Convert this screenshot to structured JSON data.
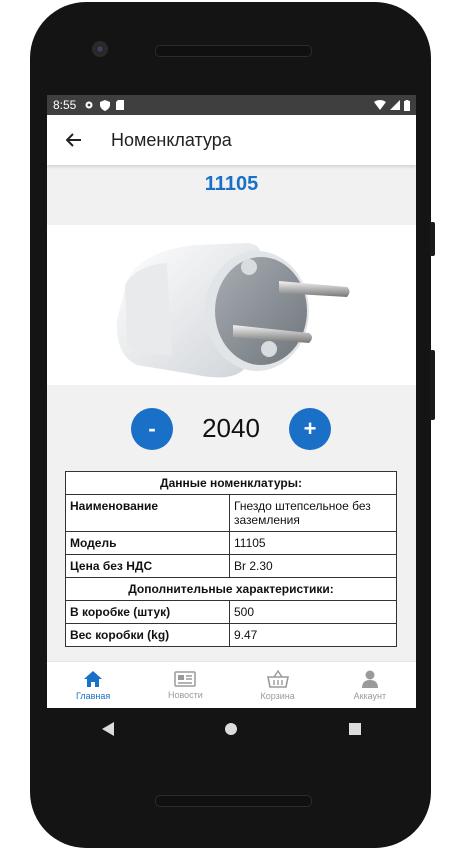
{
  "status": {
    "time": "8:55"
  },
  "appbar": {
    "title": "Номенклатура"
  },
  "product": {
    "code": "11105",
    "image_alt": "Гнездо штепсельное без заземления"
  },
  "quantity": {
    "minus_label": "-",
    "value": "2040",
    "plus_label": "+"
  },
  "table": {
    "section1": "Данные номенклатуры:",
    "rows1": [
      {
        "key": "Наименование",
        "value": "Гнездо штепсельное без заземления"
      },
      {
        "key": "Модель",
        "value": "11105"
      },
      {
        "key": "Цена без НДС",
        "value": "Br 2.30"
      }
    ],
    "section2": "Дополнительные характеристики:",
    "rows2": [
      {
        "key": "В коробке (штук)",
        "value": "500"
      },
      {
        "key": "Вес коробки (kg)",
        "value": "9.47"
      }
    ]
  },
  "nav": {
    "items": [
      {
        "label": "Главная",
        "icon": "home-icon",
        "active": true
      },
      {
        "label": "Новости",
        "icon": "newspaper-icon",
        "active": false
      },
      {
        "label": "Корзина",
        "icon": "basket-icon",
        "active": false
      },
      {
        "label": "Аккаунт",
        "icon": "user-icon",
        "active": false
      }
    ]
  },
  "colors": {
    "accent": "#1a6fc6",
    "statusbar": "#3f3f3f"
  }
}
